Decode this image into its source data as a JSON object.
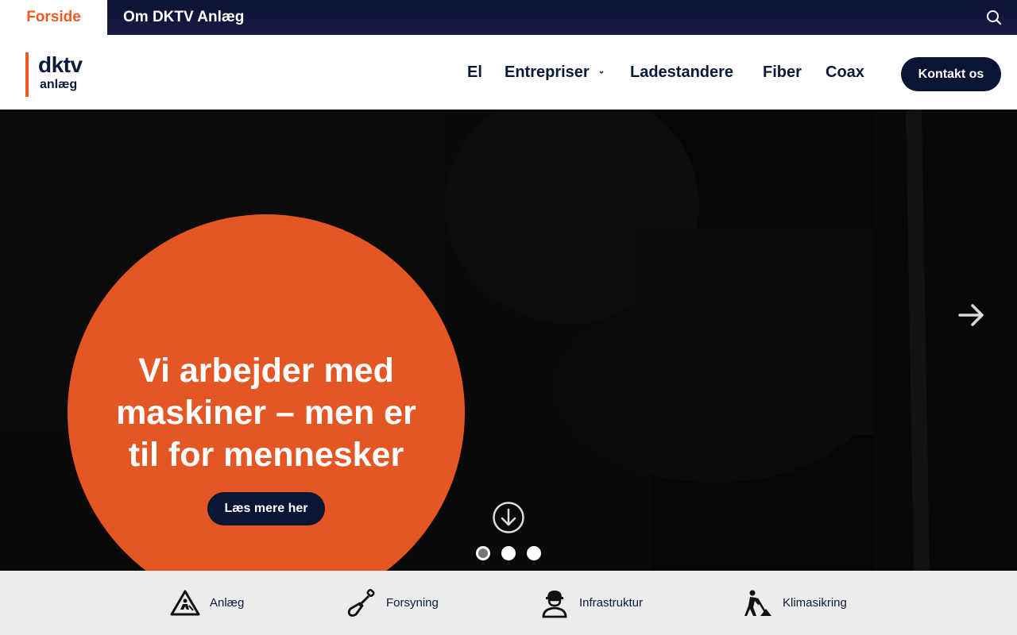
{
  "topbar": {
    "tabs": [
      {
        "label": "Forside",
        "active": true
      },
      {
        "label": "Om DKTV Anlæg",
        "active": false
      }
    ],
    "search_icon": "search-icon"
  },
  "logo": {
    "main": "dktv",
    "sub": "anlæg"
  },
  "nav": {
    "items": [
      {
        "label": "El"
      },
      {
        "label": "Entrepriser",
        "has_dropdown": true
      },
      {
        "label": "Ladestandere"
      },
      {
        "label": "Fiber"
      },
      {
        "label": "Coax"
      }
    ],
    "contact_label": "Kontakt os"
  },
  "hero": {
    "title": "Vi arbejder med maskiner – men er til for mennesker",
    "button_label": "Læs mere her",
    "slides": 3,
    "active_slide": 1
  },
  "categories": [
    {
      "label": "Anlæg",
      "icon": "road-work-icon"
    },
    {
      "label": "Forsyning",
      "icon": "shovel-icon"
    },
    {
      "label": "Infrastruktur",
      "icon": "worker-icon"
    },
    {
      "label": "Klimasikring",
      "icon": "digging-worker-icon"
    }
  ],
  "colors": {
    "accent": "#e55625",
    "navy": "#0a1533",
    "topbar": "#0a1333",
    "catbar_bg": "#ececec"
  }
}
